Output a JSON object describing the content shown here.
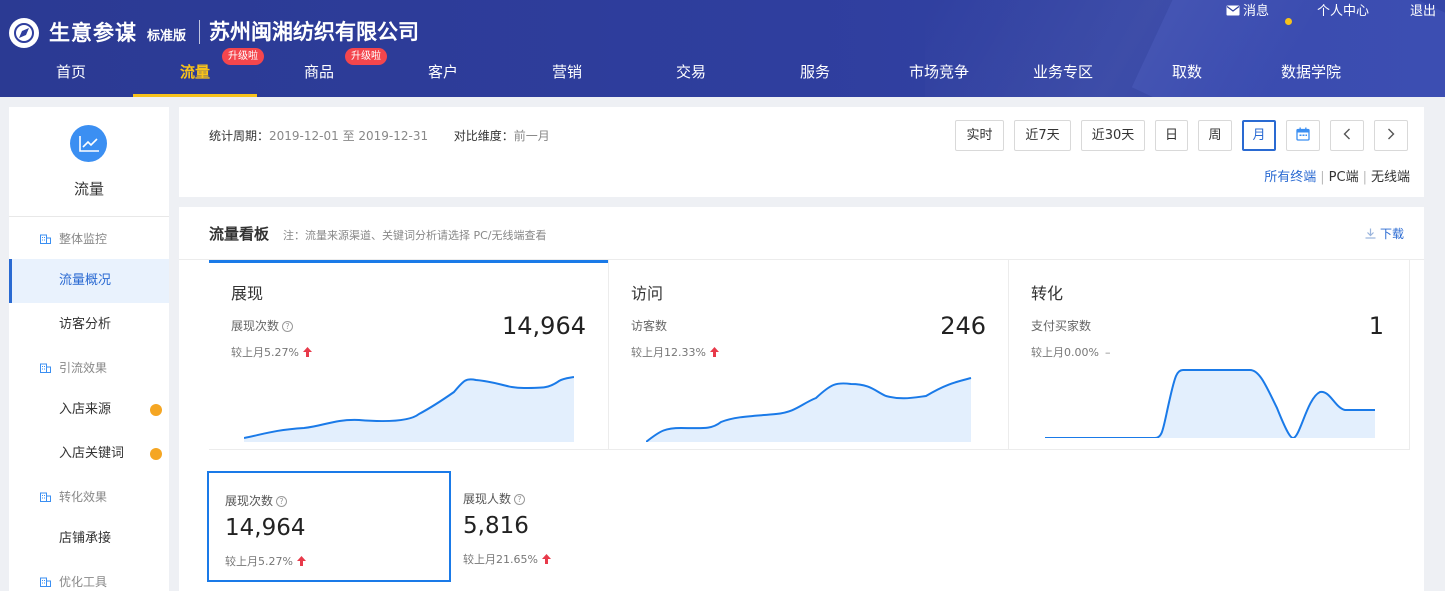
{
  "header": {
    "brand": "生意参谋",
    "edition": "标准版",
    "company": "苏州闽湘纺织有限公司",
    "links": {
      "messages": "消息",
      "profile": "个人中心",
      "logout": "退出"
    }
  },
  "nav": {
    "items": [
      {
        "label": "首页"
      },
      {
        "label": "流量",
        "badge": "升级啦"
      },
      {
        "label": "商品",
        "badge": "升级啦"
      },
      {
        "label": "客户"
      },
      {
        "label": "营销"
      },
      {
        "label": "交易"
      },
      {
        "label": "服务"
      },
      {
        "label": "市场竞争"
      },
      {
        "label": "业务专区"
      },
      {
        "label": "取数"
      },
      {
        "label": "数据学院"
      }
    ],
    "active_index": 1
  },
  "sidebar": {
    "title": "流量",
    "groups": [
      {
        "label": "整体监控"
      },
      {
        "label": "引流效果"
      },
      {
        "label": "转化效果"
      },
      {
        "label": "优化工具"
      }
    ],
    "items": [
      {
        "label": "流量概况"
      },
      {
        "label": "访客分析"
      },
      {
        "label": "入店来源"
      },
      {
        "label": "入店关键词"
      },
      {
        "label": "店铺承接"
      }
    ]
  },
  "filter": {
    "period_label": "统计周期：",
    "period_value": "2019-12-01 至 2019-12-31",
    "compare_label": "对比维度：",
    "compare_value": "前一月",
    "buttons": [
      "实时",
      "近7天",
      "近30天",
      "日",
      "周",
      "月"
    ],
    "active_button": "月",
    "terminals": [
      "所有终端",
      "PC端",
      "无线端"
    ],
    "active_terminal": "所有终端"
  },
  "board": {
    "title": "流量看板",
    "note": "注：流量来源渠道、关键词分析请选择 PC/无线端查看",
    "download": "下载",
    "cards": [
      {
        "name": "展现",
        "metric": "展现次数",
        "value": "14,964",
        "compare": "较上月5.27%",
        "trend": "up"
      },
      {
        "name": "访问",
        "metric": "访客数",
        "value": "246",
        "compare": "较上月12.33%",
        "trend": "up"
      },
      {
        "name": "转化",
        "metric": "支付买家数",
        "value": "1",
        "compare": "较上月0.00%",
        "trend": "flat",
        "trend_symbol": "–"
      }
    ],
    "sub_metrics": [
      {
        "metric": "展现次数",
        "value": "14,964",
        "compare": "较上月5.27%"
      },
      {
        "metric": "展现人数",
        "value": "5,816",
        "compare": "较上月21.65%"
      }
    ]
  },
  "colors": {
    "accent": "#2a6ad2",
    "nav_active": "#f7c21b",
    "up": "#e83a4a",
    "badge": "#f4464d",
    "chart_fill": "#e3effd",
    "chart_line": "#1a7ae8"
  }
}
